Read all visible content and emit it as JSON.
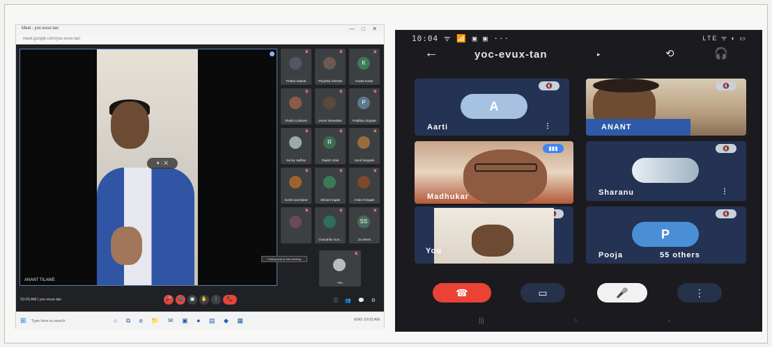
{
  "desktop": {
    "tab_title": "Meet - yoc-evux-tan",
    "window_buttons": "— □ ✕",
    "url": "meet.google.com/yoc-evux-tan",
    "main_speaker_name": "ANANT TILAWE",
    "main_overlay": "⏸ ⋮ ✕",
    "tiles": [
      {
        "name": "Pratha Sapkal",
        "initial": ""
      },
      {
        "name": "Priyanka Shende",
        "initial": ""
      },
      {
        "name": "Kavita Kokar",
        "initial": "K"
      },
      {
        "name": "Shalini Limkane",
        "initial": ""
      },
      {
        "name": "pravin shewalkar",
        "initial": ""
      },
      {
        "name": "Pratibha Jingade",
        "initial": "P"
      },
      {
        "name": "Sunny Jadhav",
        "initial": ""
      },
      {
        "name": "Rajesh Ubal",
        "initial": "R"
      },
      {
        "name": "Sunil Sargade",
        "initial": ""
      },
      {
        "name": "mohini anchatne",
        "initial": ""
      },
      {
        "name": "Shivani Ingale",
        "initial": ""
      },
      {
        "name": "Anita Chingale",
        "initial": ""
      },
      {
        "name": "",
        "initial": ""
      },
      {
        "name": "Chandrika Gon...",
        "initial": ""
      },
      {
        "name": "33 others",
        "initial": "SS"
      },
      {
        "name": "You",
        "initial": ""
      }
    ],
    "tooltip": "Participants in this meeting",
    "meeting_time": "10:03 AM | yoc-evux-tan",
    "controls": [
      "🎤",
      "📹",
      "▣",
      "✋",
      "⋮",
      "📞"
    ],
    "right_icons": "ⓘ 👥 💬 ⚙",
    "taskbar_search": "Type here to search",
    "taskbar_icons": "○ ⧉ e 📁 ✉ ▣ ● ▤ ◆ ▦",
    "tray": "ENG 10:03 AM"
  },
  "phone": {
    "status_time": "10:04 ᯤ 📶 ▣ ▣ ···",
    "status_right": "LTE ᯤ ◐ ▭",
    "back_icon": "←",
    "meeting_code": "yoc-evux-tan",
    "caret": "▸",
    "camera_flip_icon": "⟲",
    "audio_icon": "🎧",
    "participants": {
      "aarti": {
        "label": "Aarti",
        "initial": "A"
      },
      "anant": {
        "label": "ANANT"
      },
      "speaker": {
        "label": "Madhukar"
      },
      "sharanu": {
        "label": "Sharanu"
      },
      "you": {
        "label": "You"
      },
      "pooja": {
        "label": "Pooja",
        "initial": "P",
        "others": "55 others"
      }
    },
    "mute_icon": "🔇",
    "more_icon": "⋮",
    "speaking_icon": "▮▮▮",
    "end_call_icon": "☎",
    "video_icon": "▭",
    "mic_icon": "🎤",
    "menu_icon": "⋮",
    "nav": [
      "|||",
      "○",
      "‹"
    ]
  }
}
